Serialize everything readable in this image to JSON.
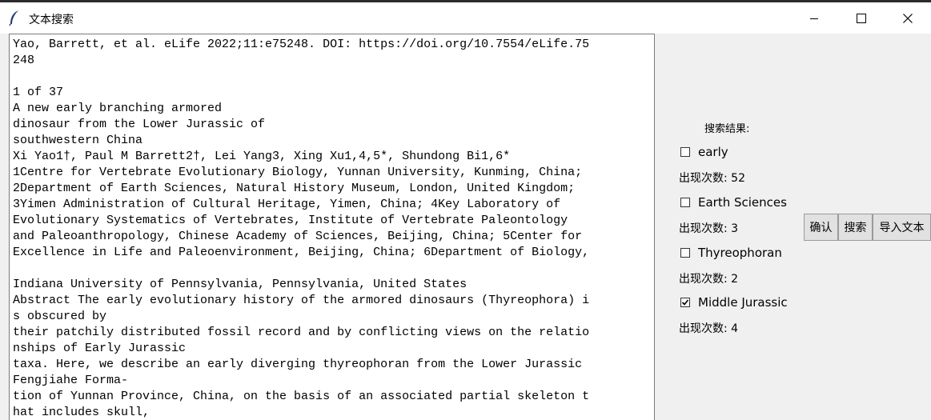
{
  "window": {
    "title": "文本搜索"
  },
  "document": {
    "lines": [
      "Yao, Barrett, et al. eLife 2022;11:e75248. DOI: https://doi.org/10.7554/eLife.75",
      "248",
      "",
      "1 of 37",
      "A new early branching armored",
      "dinosaur from the Lower Jurassic of",
      "southwestern China",
      "Xi Yao1†, Paul M Barrett2†, Lei Yang3, Xing Xu1,4,5*, Shundong Bi1,6*",
      "1Centre for Vertebrate Evolutionary Biology, Yunnan University, Kunming, China;",
      "2Department of Earth Sciences, Natural History Museum, London, United Kingdom;",
      "3Yimen Administration of Cultural Heritage, Yimen, China; 4Key Laboratory of",
      "Evolutionary Systematics of Vertebrates, Institute of Vertebrate Paleontology",
      "and Paleoanthropology, Chinese Academy of Sciences, Beijing, China; 5Center for",
      "Excellence in Life and Paleoenvironment, Beijing, China; 6Department of Biology,",
      "",
      "Indiana University of Pennsylvania, Pennsylvania, United States",
      "Abstract The early evolutionary history of the armored dinosaurs (Thyreophora) i",
      "s obscured by",
      "their patchily distributed fossil record and by conflicting views on the relatio",
      "nships of Early Jurassic",
      "taxa. Here, we describe an early diverging thyreophoran from the Lower Jurassic",
      "Fengjiahe Forma-",
      "tion of Yunnan Province, China, on the basis of an associated partial skeleton t",
      "hat includes skull,"
    ]
  },
  "results": {
    "label": "搜索结果:",
    "items": [
      {
        "term": "early",
        "checked": false,
        "count_text": "出现次数: 52"
      },
      {
        "term": "Earth Sciences",
        "checked": false,
        "count_text": "出现次数: 3"
      },
      {
        "term": "Thyreophoran",
        "checked": false,
        "count_text": "出现次数: 2"
      },
      {
        "term": "Middle Jurassic",
        "checked": true,
        "count_text": "出现次数: 4"
      }
    ]
  },
  "buttons": {
    "confirm": "确认",
    "search": "搜索",
    "import": "导入文本"
  }
}
